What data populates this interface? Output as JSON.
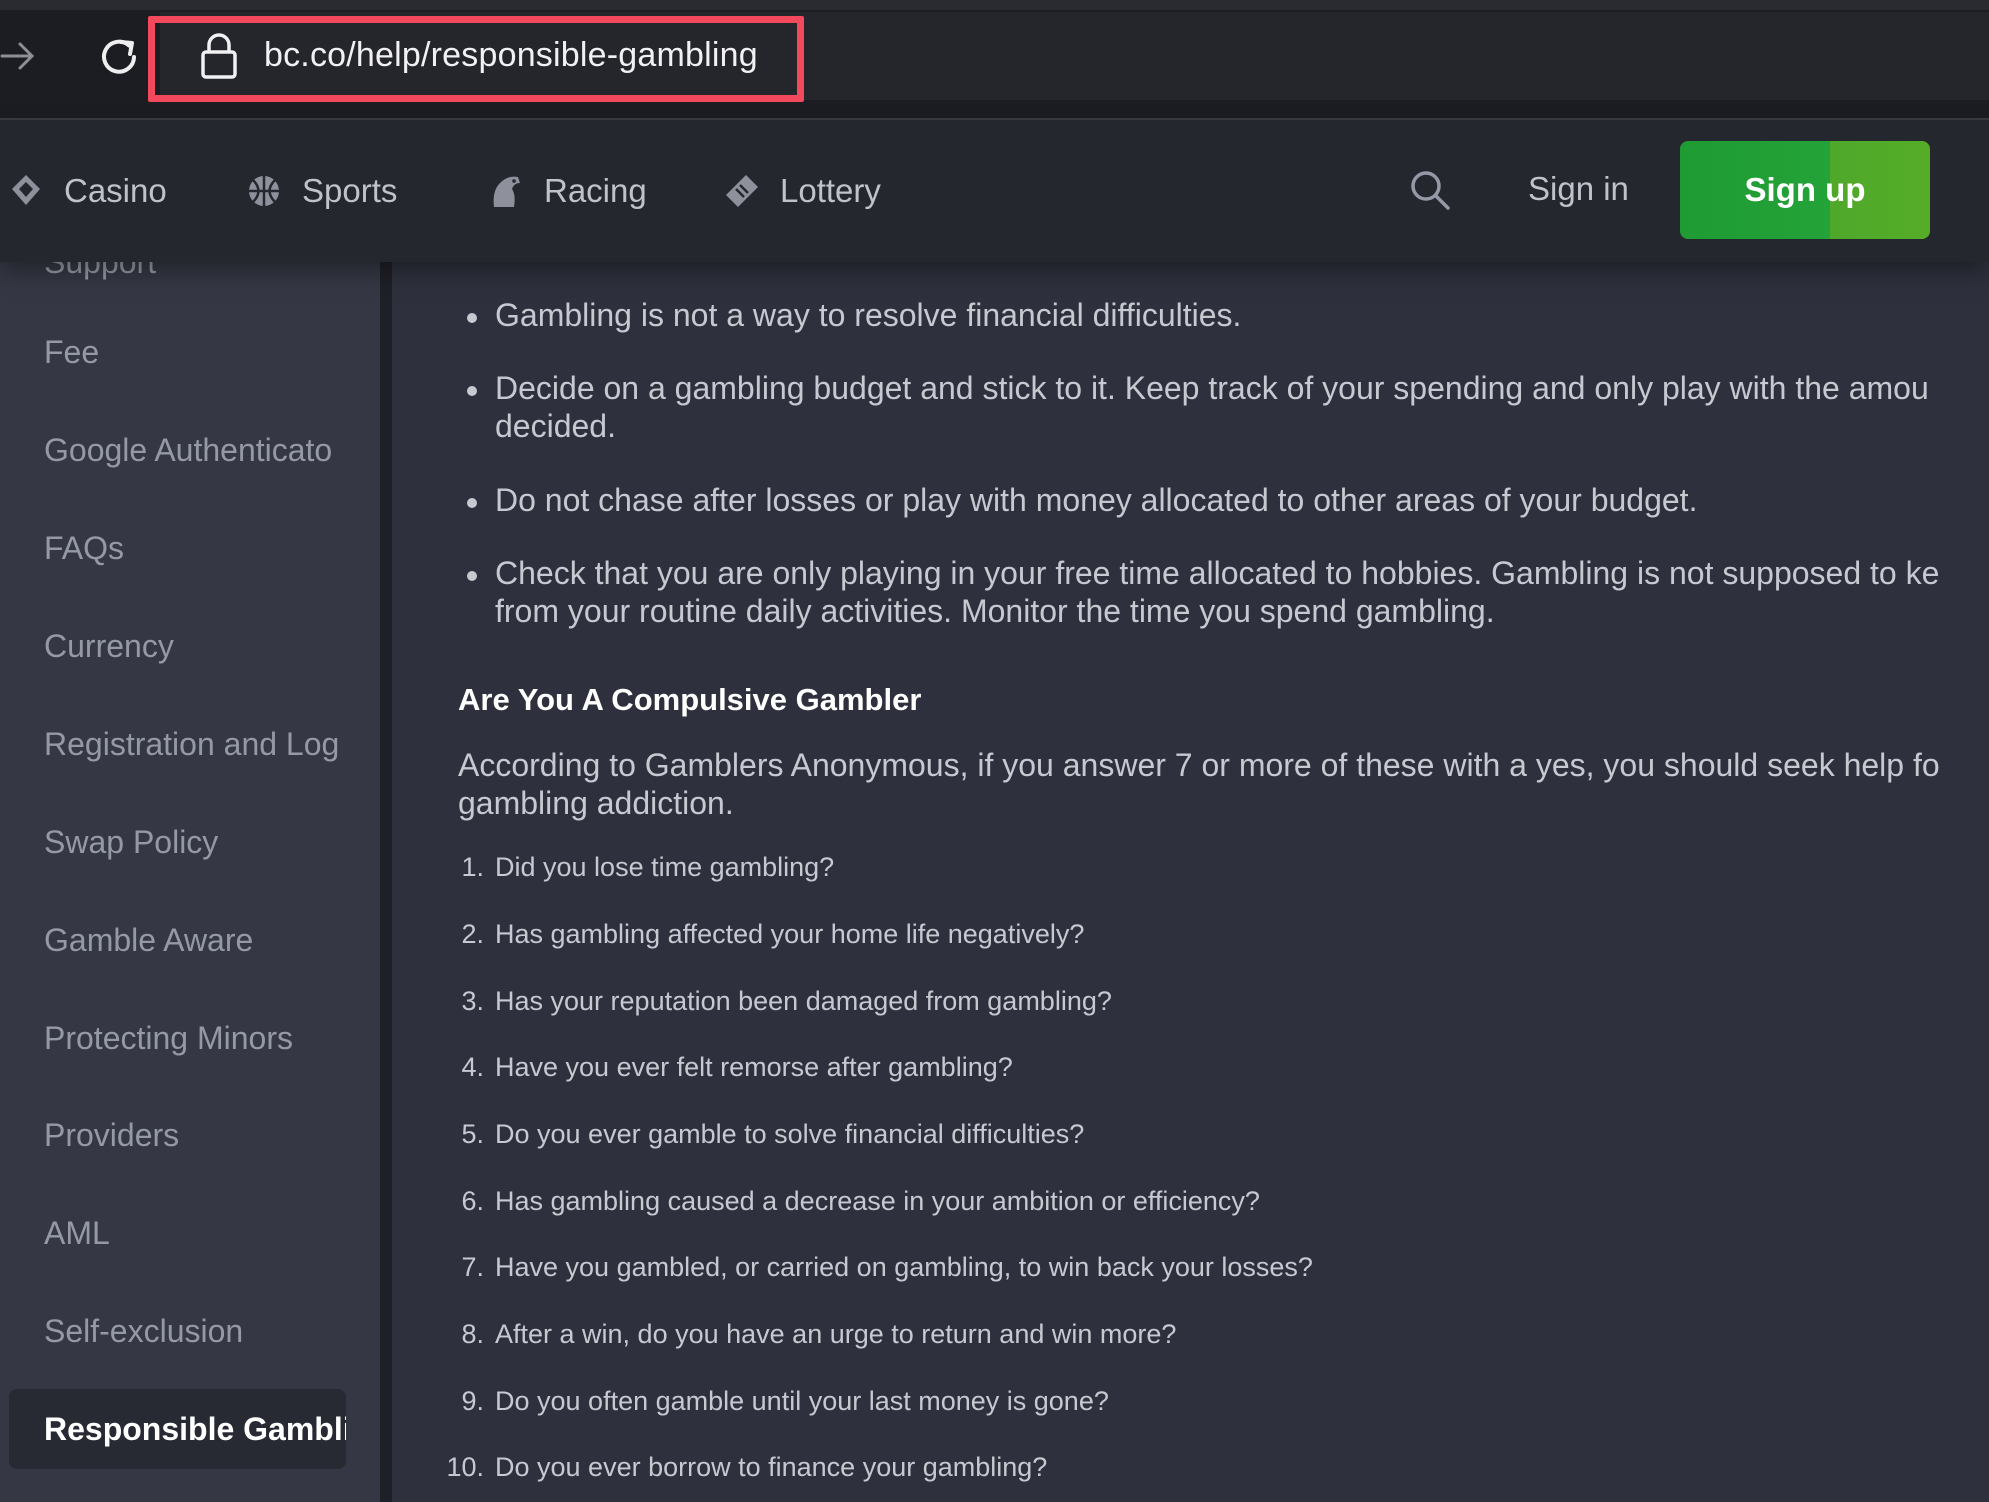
{
  "browser": {
    "url": "bc.co/help/responsible-gambling"
  },
  "header": {
    "nav": [
      {
        "label": "Casino",
        "icon": "casino-chip-icon"
      },
      {
        "label": "Sports",
        "icon": "sports-ball-icon"
      },
      {
        "label": "Racing",
        "icon": "horse-icon"
      },
      {
        "label": "Lottery",
        "icon": "lottery-ticket-icon"
      }
    ],
    "signin_label": "Sign in",
    "signup_label": "Sign up",
    "signup_color": "#23a338"
  },
  "sidebar": {
    "partial_label": "Support",
    "items": [
      {
        "label": "Fee"
      },
      {
        "label": "Google Authenticato"
      },
      {
        "label": "FAQs"
      },
      {
        "label": "Currency"
      },
      {
        "label": "Registration and Log"
      },
      {
        "label": "Swap Policy"
      },
      {
        "label": "Gamble Aware"
      },
      {
        "label": "Protecting Minors"
      },
      {
        "label": "Providers"
      },
      {
        "label": "AML"
      },
      {
        "label": "Self-exclusion"
      },
      {
        "label": "Responsible Gambli"
      }
    ]
  },
  "content": {
    "bullets": [
      "Gambling is not a way to resolve financial difficulties.",
      "Decide on a gambling budget and stick to it. Keep track of your spending and only play with the amou",
      "decided.",
      "Do not chase after losses or play with money allocated to other areas of your budget.",
      "Check that you are only playing in your free time allocated to hobbies. Gambling is not supposed to ke",
      "from your routine daily activities. Monitor the time you spend gambling."
    ],
    "heading": "Are You A Compulsive Gambler",
    "intro_line1": "According to Gamblers Anonymous, if you answer 7 or more of these with a yes, you should seek help fo",
    "intro_line2": "gambling addiction.",
    "questions": [
      {
        "num": "1.",
        "text": "Did you lose time gambling?"
      },
      {
        "num": "2.",
        "text": "Has gambling affected your home life negatively?"
      },
      {
        "num": "3.",
        "text": "Has your reputation been damaged from gambling?"
      },
      {
        "num": "4.",
        "text": "Have you ever felt remorse after gambling?"
      },
      {
        "num": "5.",
        "text": "Do you ever gamble to solve financial difficulties?"
      },
      {
        "num": "6.",
        "text": "Has gambling caused a decrease in your ambition or efficiency?"
      },
      {
        "num": "7.",
        "text": "Have you gambled, or carried on gambling, to win back your losses?"
      },
      {
        "num": "8.",
        "text": "After a win, do you have an urge to return and win more?"
      },
      {
        "num": "9.",
        "text": "Do you often gamble until your last money is gone?"
      },
      {
        "num": "10.",
        "text": "Do you ever borrow to finance your gambling?"
      }
    ]
  }
}
